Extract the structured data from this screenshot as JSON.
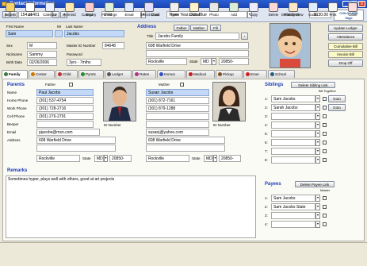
{
  "window": {
    "title": "Contact Information"
  },
  "toolbar": {
    "record_counter": "154 of 401",
    "category_label": "Category",
    "category_value": "child",
    "class_label": "Class",
    "class_value": "Three Year Olds-Blue",
    "date": "09/08/2009",
    "balance": "$130.00",
    "logo_text": "CHILDCARE Sage"
  },
  "child": {
    "first_name_label": "First Name",
    "mi_label": "MI",
    "last_name_label": "Last Name",
    "first_name": "Sam",
    "last_name": "Jacobs",
    "sex_label": "Sex",
    "sex": "M",
    "master_id_label": "Master ID Number",
    "master_id": "84648",
    "nickname_label": "Nickname",
    "nickname": "Sammy",
    "password_label": "Password",
    "birth_date_label": "Birth Date",
    "birth_date": "02/26/2006",
    "age": "3yrs - 7mths"
  },
  "address": {
    "header": "Address",
    "tabs": [
      "Father",
      "Mother",
      "Fill"
    ],
    "title_label": "Title",
    "title": "Jacobs Family",
    "street": "608 Warfield Drive",
    "city": "Rockville",
    "state_label": "State",
    "state": "MD",
    "zip": "20850-"
  },
  "side_buttons": [
    "Update Ledger",
    "Attendance",
    "Cumulative Bill",
    "Invoice Bill",
    "Drop Off"
  ],
  "tabs": [
    {
      "label": "Family",
      "color": "#3a7a3a"
    },
    {
      "label": "Center",
      "color": "#cc7a00"
    },
    {
      "label": "Child",
      "color": "#c03030"
    },
    {
      "label": "Pymts",
      "color": "#2a8a2a"
    },
    {
      "label": "Ledger",
      "color": "#555"
    },
    {
      "label": "Rates",
      "color": "#b03080"
    },
    {
      "label": "Immun",
      "color": "#3050c0"
    },
    {
      "label": "Medical",
      "color": "#c02020"
    },
    {
      "label": "Pickup",
      "color": "#805020"
    },
    {
      "label": "Emer",
      "color": "#d02020"
    },
    {
      "label": "School",
      "color": "#206080"
    }
  ],
  "parents": {
    "header": "Parents",
    "father_label": "Father",
    "mother_label": "Mother",
    "row_labels": [
      "Name",
      "Home Phone",
      "Work Phone",
      "Cell Phone",
      "Beeper",
      "Email",
      "Address"
    ],
    "father": {
      "name": "Paul Jacobs",
      "home": "(301) 537-4754",
      "work": "(301) 728-2716",
      "cell": "(301) 276-2791",
      "beeper": "",
      "email": "pjacobs@msn.com",
      "street": "608 Warfield Drive",
      "city": "Rockville",
      "state": "MD",
      "zip": "20850-"
    },
    "mother": {
      "name": "Susan Jacobs",
      "home": "(301) 872-7161",
      "work": "(301) 879-1288",
      "cell": "",
      "beeper": "",
      "email": "susanj@yahoo.com",
      "street": "608 Warfield Drive",
      "city": "Rockville",
      "state": "MD",
      "zip": "20850-"
    },
    "id_label": "ID Number",
    "state_label": "State"
  },
  "siblings": {
    "header": "Siblings",
    "delete_label": "Delete Sibling Link",
    "bill_together": "Bill Together",
    "rows": [
      {
        "num": "1:",
        "name": "Sam Jacobs",
        "go": "Goto"
      },
      {
        "num": "2:",
        "name": "Sarah Jacobs",
        "go": "Goto"
      },
      {
        "num": "3:",
        "name": ""
      },
      {
        "num": "4:",
        "name": ""
      },
      {
        "num": "5:",
        "name": ""
      },
      {
        "num": "6:",
        "name": ""
      },
      {
        "num": "7:",
        "name": ""
      },
      {
        "num": "8:",
        "name": ""
      }
    ]
  },
  "payees": {
    "header": "Payees",
    "delete_label": "Delete Payee Link",
    "master": "Master",
    "rows": [
      {
        "num": "1:",
        "name": "Sam Jacobs"
      },
      {
        "num": "2:",
        "name": "Sam Jacobs State"
      },
      {
        "num": "3:",
        "name": ""
      },
      {
        "num": "4:",
        "name": ""
      }
    ]
  },
  "remarks": {
    "header": "Remarks",
    "text": "Sometimes hyper, plays well with others, good at art projects"
  },
  "bottom_buttons": [
    {
      "label": "Search",
      "icon": "search-icon"
    },
    {
      "label": "List",
      "icon": "list-icon"
    },
    {
      "label": "Calendar",
      "icon": "calendar-icon"
    },
    {
      "label": "Remind",
      "icon": "remind-icon"
    },
    {
      "label": "End",
      "icon": "end-icon"
    },
    {
      "label": "Fill Merge",
      "icon": "fill-merge-icon"
    },
    {
      "label": "Email",
      "icon": "email-icon"
    },
    {
      "label": "Select Email",
      "icon": "select-email-icon"
    },
    {
      "label": "Agets",
      "icon": "agets-icon"
    },
    {
      "label": "Journal",
      "icon": "journal-icon"
    },
    {
      "label": "Photo",
      "icon": "photo-icon"
    },
    {
      "label": "Add",
      "icon": "add-icon"
    },
    {
      "label": "Copy",
      "icon": "copy-icon"
    },
    {
      "label": "Delete",
      "icon": "delete-icon"
    },
    {
      "label": "Family View",
      "icon": "family-view-icon"
    },
    {
      "label": "Guide",
      "icon": "guide-icon"
    },
    {
      "label": "Print",
      "icon": "print-icon"
    },
    {
      "label": "Close",
      "icon": "close-icon"
    }
  ]
}
